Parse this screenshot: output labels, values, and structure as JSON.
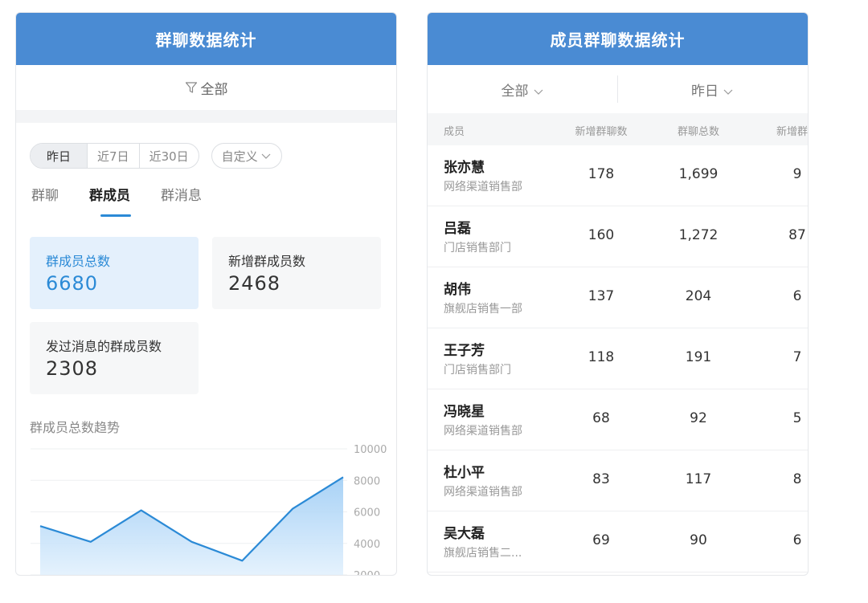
{
  "left": {
    "title": "群聊数据统计",
    "filter_label": "全部",
    "time_segments": [
      "昨日",
      "近7日",
      "近30日"
    ],
    "custom_label": "自定义",
    "tabs": [
      "群聊",
      "群成员",
      "群消息"
    ],
    "active_tab": "群成员",
    "stats": [
      {
        "label": "群成员总数",
        "value": "6680",
        "active": true
      },
      {
        "label": "新增群成员数",
        "value": "2468",
        "active": false
      },
      {
        "label": "发过消息的群成员数",
        "value": "2308",
        "active": false
      }
    ],
    "trend_title": "群成员总数趋势"
  },
  "chart_data": {
    "type": "area",
    "x": [
      1,
      2,
      3,
      4,
      5,
      6,
      7
    ],
    "values": [
      5100,
      4100,
      6100,
      4100,
      2900,
      6200,
      8200
    ],
    "ylim": [
      2000,
      10000
    ],
    "yticks": [
      "10000",
      "8000",
      "6000",
      "4000",
      "2000"
    ],
    "grid": true,
    "line_color": "#2b8ad6"
  },
  "right": {
    "title": "成员群聊数据统计",
    "filter_all": "全部",
    "filter_date": "昨日",
    "columns": [
      "成员",
      "新增群聊数",
      "群聊总数",
      "新增群"
    ],
    "rows": [
      {
        "name": "张亦慧",
        "dept": "网络渠道销售部",
        "new_groups": "178",
        "total_groups": "1,699",
        "extra": "9"
      },
      {
        "name": "吕磊",
        "dept": "门店销售部门",
        "new_groups": "160",
        "total_groups": "1,272",
        "extra": "87"
      },
      {
        "name": "胡伟",
        "dept": "旗舰店销售一部",
        "new_groups": "137",
        "total_groups": "204",
        "extra": "6"
      },
      {
        "name": "王子芳",
        "dept": "门店销售部门",
        "new_groups": "118",
        "total_groups": "191",
        "extra": "7"
      },
      {
        "name": "冯晓星",
        "dept": "网络渠道销售部",
        "new_groups": "68",
        "total_groups": "92",
        "extra": "5"
      },
      {
        "name": "杜小平",
        "dept": "网络渠道销售部",
        "new_groups": "83",
        "total_groups": "117",
        "extra": "8"
      },
      {
        "name": "吴大磊",
        "dept": "旗舰店销售二...",
        "new_groups": "69",
        "total_groups": "90",
        "extra": "6"
      }
    ]
  }
}
